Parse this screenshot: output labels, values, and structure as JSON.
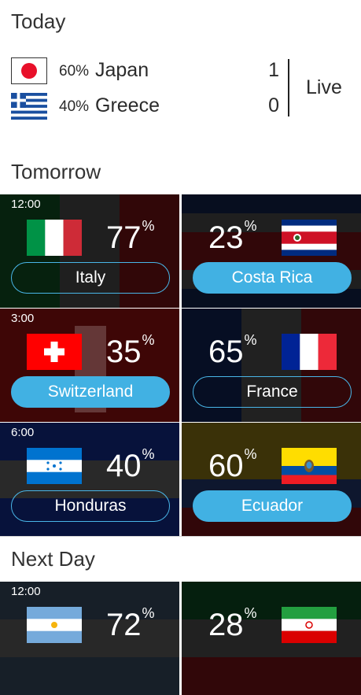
{
  "today": {
    "title": "Today",
    "status": "Live",
    "teams": [
      {
        "name": "Japan",
        "percent": "60%",
        "score": "1",
        "flag": "japan-flag"
      },
      {
        "name": "Greece",
        "percent": "40%",
        "score": "0",
        "flag": "greece-flag"
      }
    ]
  },
  "tomorrow": {
    "title": "Tomorrow",
    "matches": [
      {
        "time": "12:00",
        "home": {
          "name": "Italy",
          "percent": "77",
          "flag": "italy-flag",
          "selected": false
        },
        "away": {
          "name": "Costa Rica",
          "percent": "23",
          "flag": "costa-rica-flag",
          "selected": true
        }
      },
      {
        "time": "3:00",
        "home": {
          "name": "Switzerland",
          "percent": "35",
          "flag": "switzerland-flag",
          "selected": true
        },
        "away": {
          "name": "France",
          "percent": "65",
          "flag": "france-flag",
          "selected": false
        }
      },
      {
        "time": "6:00",
        "home": {
          "name": "Honduras",
          "percent": "40",
          "flag": "honduras-flag",
          "selected": false
        },
        "away": {
          "name": "Ecuador",
          "percent": "60",
          "flag": "ecuador-flag",
          "selected": true
        }
      }
    ]
  },
  "next_day": {
    "title": "Next Day",
    "matches": [
      {
        "time": "12:00",
        "home": {
          "name": "Argentina",
          "percent": "72",
          "flag": "argentina-flag"
        },
        "away": {
          "name": "Iran",
          "percent": "28",
          "flag": "iran-flag"
        }
      }
    ]
  },
  "percent_sign": "%",
  "colors": {
    "accent": "#41b1e3",
    "text": "#2b2b2b"
  }
}
